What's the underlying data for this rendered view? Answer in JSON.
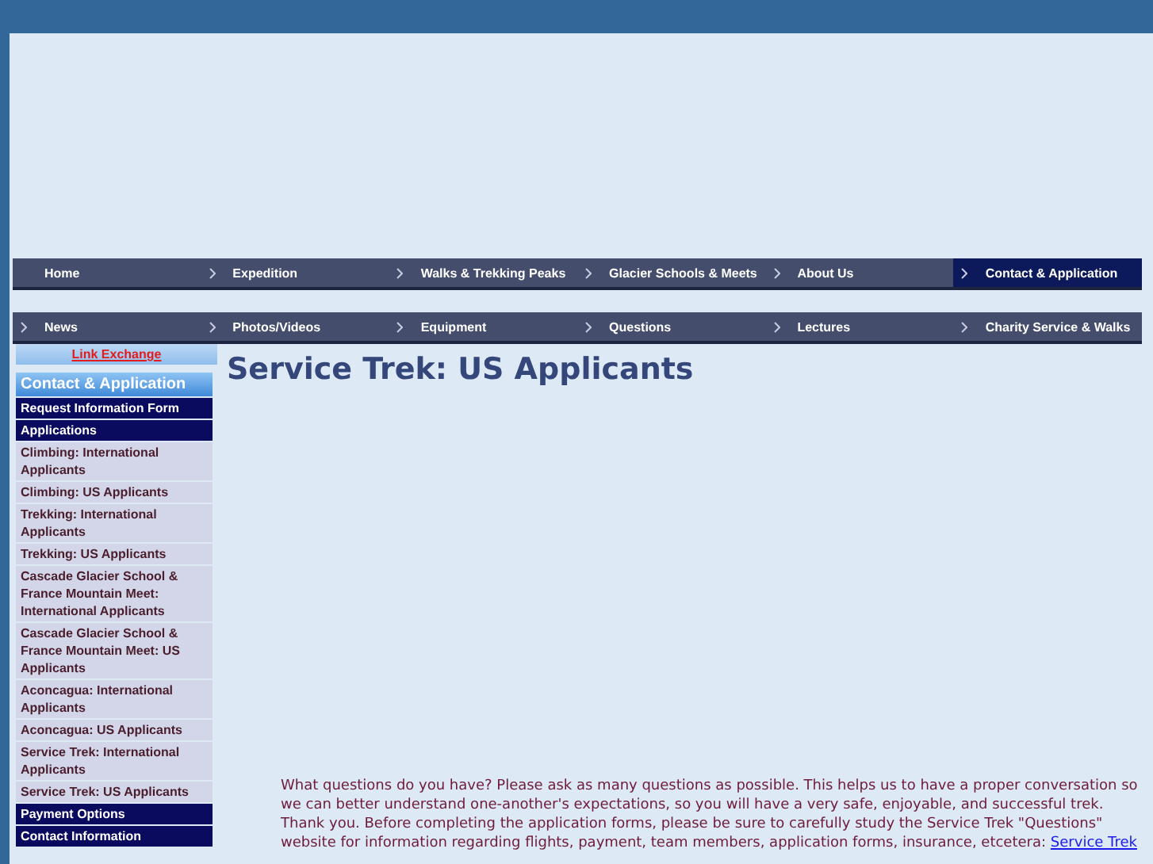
{
  "nav_rows": [
    [
      {
        "label": "Home",
        "selected": false,
        "arrow": false
      },
      {
        "label": "Expedition",
        "selected": false,
        "arrow": true
      },
      {
        "label": "Walks & Trekking Peaks",
        "selected": false,
        "arrow": true
      },
      {
        "label": "Glacier Schools & Meets",
        "selected": false,
        "arrow": true
      },
      {
        "label": "About Us",
        "selected": false,
        "arrow": true
      },
      {
        "label": "Contact & Application",
        "selected": true,
        "arrow": true
      }
    ],
    [
      {
        "label": "News",
        "selected": false,
        "arrow": true
      },
      {
        "label": "Photos/Videos",
        "selected": false,
        "arrow": true
      },
      {
        "label": "Equipment",
        "selected": false,
        "arrow": true
      },
      {
        "label": "Questions",
        "selected": false,
        "arrow": true
      },
      {
        "label": "Lectures",
        "selected": false,
        "arrow": true
      },
      {
        "label": "Charity Service & Walks",
        "selected": false,
        "arrow": true
      }
    ]
  ],
  "sidebar": {
    "link_exchange": "Link Exchange",
    "section_title": "Contact & Application",
    "items": [
      {
        "label": "Request Information Form",
        "kind": "group"
      },
      {
        "label": "Applications",
        "kind": "group"
      },
      {
        "label": "Climbing: International Applicants",
        "kind": "sub"
      },
      {
        "label": "Climbing: US Applicants",
        "kind": "sub"
      },
      {
        "label": "Trekking: International Applicants",
        "kind": "sub"
      },
      {
        "label": "Trekking: US Applicants",
        "kind": "sub"
      },
      {
        "label": "Cascade Glacier School & France Mountain Meet: International Applicants",
        "kind": "sub"
      },
      {
        "label": "Cascade Glacier School & France Mountain Meet: US Applicants",
        "kind": "sub"
      },
      {
        "label": "Aconcagua: International Applicants",
        "kind": "sub"
      },
      {
        "label": "Aconcagua: US Applicants",
        "kind": "sub"
      },
      {
        "label": "Service Trek: International Applicants",
        "kind": "sub"
      },
      {
        "label": "Service Trek: US Applicants",
        "kind": "sub"
      },
      {
        "label": "Payment Options",
        "kind": "group"
      },
      {
        "label": "Contact Information",
        "kind": "group"
      }
    ]
  },
  "main": {
    "title": "Service Trek: US Applicants",
    "paragraph": "What questions do you have? Please ask as many questions as possible. This helps us to have a proper conversation so we can better understand one-another's expectations, so you will have a very safe, enjoyable, and successful trek. Thank you. Before completing the application forms, please be sure to carefully study the Service Trek \"Questions\" website for information regarding flights, payment, team members, application forms, insurance, etcetera:",
    "link": "Service Trek"
  }
}
